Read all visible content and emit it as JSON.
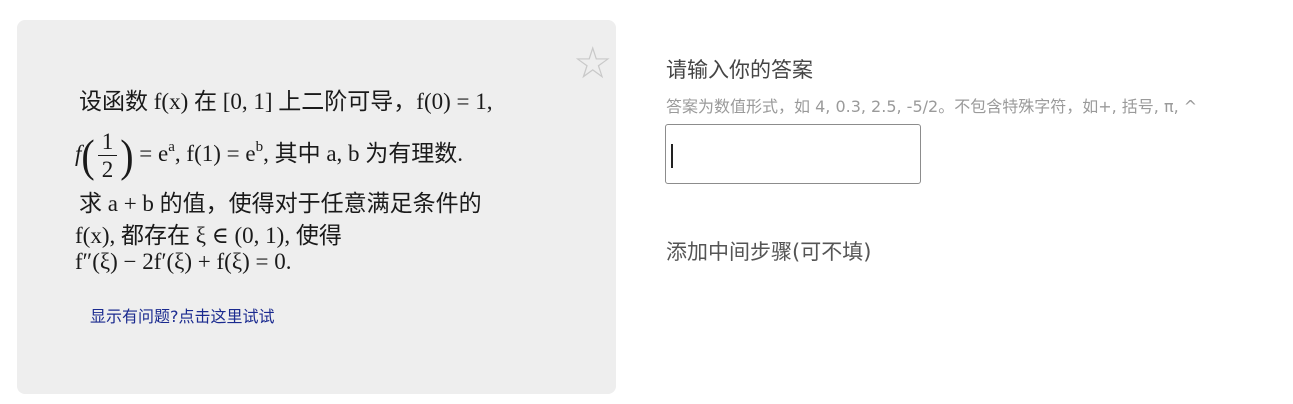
{
  "card": {
    "favorite_icon": "☆",
    "problem_lines": {
      "l1": "设函数 f(x) 在 [0, 1] 上二阶可导，f(0) = 1,",
      "l2_prefix": "f",
      "l2_frac_num": "1",
      "l2_frac_den": "2",
      "l2_after_frac": " = e",
      "l2_sup_a": "a",
      "l2_mid": ", f(1) = e",
      "l2_sup_b": "b",
      "l2_suffix": ", 其中 a, b 为有理数.",
      "l3": "求 a + b 的值，使得对于任意满足条件的",
      "l4": "f(x), 都存在 ξ ∈ (0, 1), 使得",
      "l5": "f″(ξ) − 2f′(ξ) + f(ξ) = 0."
    },
    "help_link": "显示有问题?点击这里试试"
  },
  "answer": {
    "title": "请输入你的答案",
    "hint": "答案为数值形式，如 4, 0.3, 2.5, -5/2。不包含特殊字符，如+, 括号, π, ^",
    "value": ""
  },
  "steps": {
    "label": "添加中间步骤(可不填)"
  }
}
